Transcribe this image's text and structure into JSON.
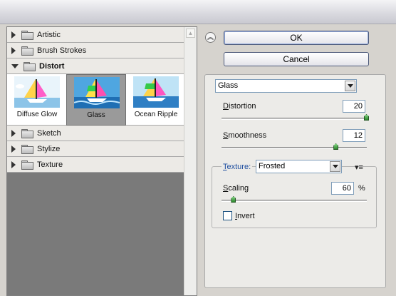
{
  "filter_list": {
    "categories": [
      {
        "label": "Artistic",
        "open": false
      },
      {
        "label": "Brush Strokes",
        "open": false
      },
      {
        "label": "Distort",
        "open": true
      },
      {
        "label": "Sketch",
        "open": false
      },
      {
        "label": "Stylize",
        "open": false
      },
      {
        "label": "Texture",
        "open": false
      }
    ],
    "thumbnails": [
      {
        "caption": "Diffuse Glow",
        "selected": false
      },
      {
        "caption": "Glass",
        "selected": true
      },
      {
        "caption": "Ocean Ripple",
        "selected": false
      }
    ],
    "scroll_up_icon": "triangle-up-icon"
  },
  "buttons": {
    "ok": "OK",
    "cancel": "Cancel",
    "collapse_icon": "double-chevron-up-icon"
  },
  "settings": {
    "filter_select": "Glass",
    "distortion": {
      "label_u": "D",
      "label_rest": "istortion",
      "value": "20",
      "level": 20,
      "max": 20
    },
    "smoothness": {
      "label_u": "S",
      "label_rest": "moothness",
      "value": "12",
      "level": 12,
      "max": 15
    },
    "texture": {
      "label_u": "T",
      "label_rest": "exture:",
      "value": "Frosted"
    },
    "texture_menu_icon": "flyout-menu-icon",
    "scaling": {
      "label_u": "S",
      "label_rest": "caling",
      "value": "60",
      "unit": "%",
      "level": 60,
      "min": 50,
      "max": 200
    },
    "invert": {
      "label_u": "I",
      "label_rest": "nvert",
      "checked": false
    }
  }
}
